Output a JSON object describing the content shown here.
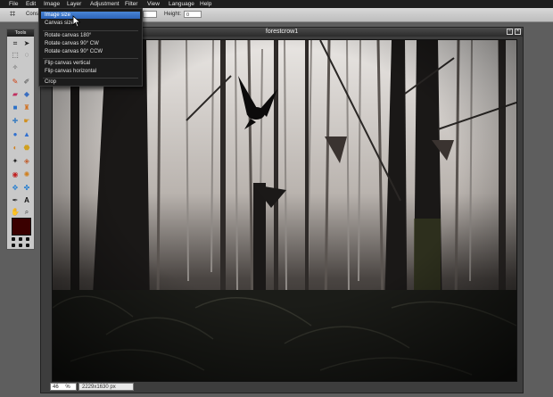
{
  "menubar": {
    "items": [
      "File",
      "Edit",
      "Image",
      "Layer",
      "Adjustment",
      "Filter",
      "View",
      "Language",
      "Help"
    ]
  },
  "optionsbar": {
    "constrain_label": "Cons",
    "height_label": "Height:",
    "height_value": "0"
  },
  "tools": {
    "title": "Tools"
  },
  "image_menu": {
    "items": [
      "Image size",
      "Canvas size",
      "Rotate canvas 180°",
      "Rotate canvas 90° CW",
      "Rotate canvas 90° CCW",
      "Flip canvas vertical",
      "Flip canvas horizontal",
      "Crop"
    ],
    "highlighted": "Image size"
  },
  "document": {
    "title": "forestcrow1",
    "zoom_value": "46",
    "zoom_unit": "%",
    "dimensions": "2229x1630 px"
  },
  "colors": {
    "foreground": "#3a0000",
    "highlight": "#2c63b8"
  }
}
